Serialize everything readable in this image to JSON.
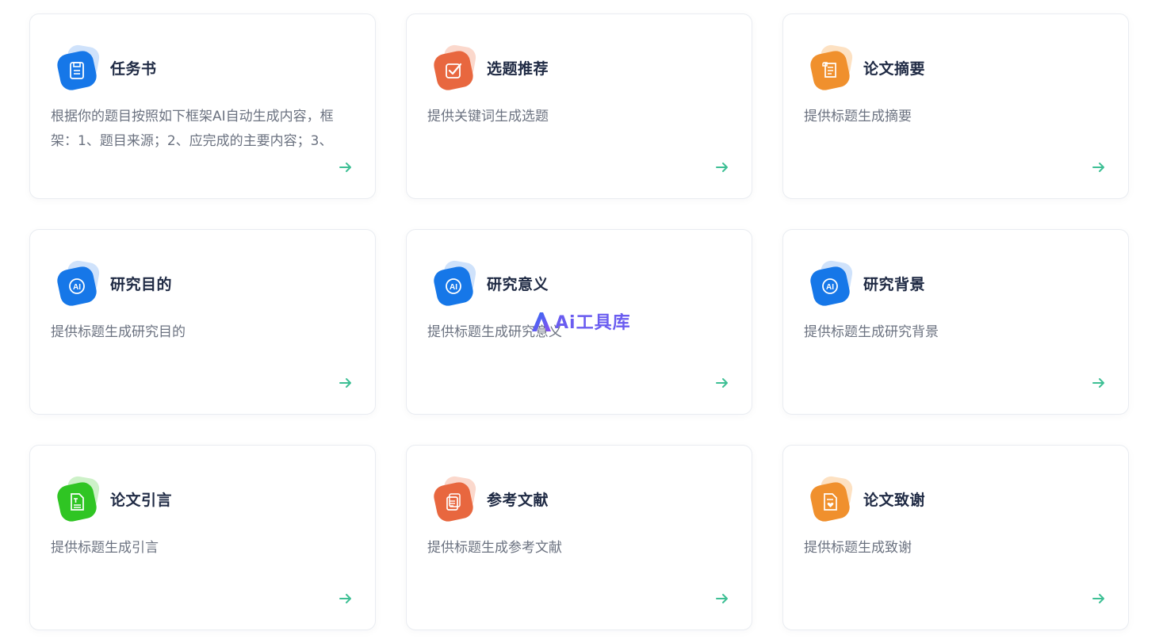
{
  "colors": {
    "blue": "#1677e8",
    "blue_halo": "#cfe2fb",
    "red_orange": "#e8673f",
    "red_orange_halo": "#fbd8cc",
    "orange": "#f0902d",
    "orange_halo": "#fde1c2",
    "green": "#2fc523",
    "green_halo": "#cdf1c8",
    "arrow": "#3dbf94",
    "watermark": "#6a5cf0"
  },
  "cards": [
    {
      "title": "任务书",
      "desc": "根据你的题目按照如下框架AI自动生成内容，框架：1、题目来源；2、应完成的主要内容；3、",
      "icon": "save-document-icon",
      "color": "blue"
    },
    {
      "title": "选题推荐",
      "desc": "提供关键词生成选题",
      "icon": "check-box-icon",
      "color": "red_orange"
    },
    {
      "title": "论文摘要",
      "desc": "提供标题生成摘要",
      "icon": "scroll-document-icon",
      "color": "orange"
    },
    {
      "title": "研究目的",
      "desc": "提供标题生成研究目的",
      "icon": "ai-badge-icon",
      "color": "blue"
    },
    {
      "title": "研究意义",
      "desc": "提供标题生成研究意义",
      "icon": "ai-badge-icon",
      "color": "blue"
    },
    {
      "title": "研究背景",
      "desc": "提供标题生成研究背景",
      "icon": "ai-badge-icon",
      "color": "blue"
    },
    {
      "title": "论文引言",
      "desc": "提供标题生成引言",
      "icon": "text-document-icon",
      "color": "green"
    },
    {
      "title": "参考文献",
      "desc": "提供标题生成参考文献",
      "icon": "stacked-documents-icon",
      "color": "red_orange"
    },
    {
      "title": "论文致谢",
      "desc": "提供标题生成致谢",
      "icon": "heart-document-icon",
      "color": "orange"
    }
  ],
  "watermark": {
    "text": "Ai工具库"
  }
}
